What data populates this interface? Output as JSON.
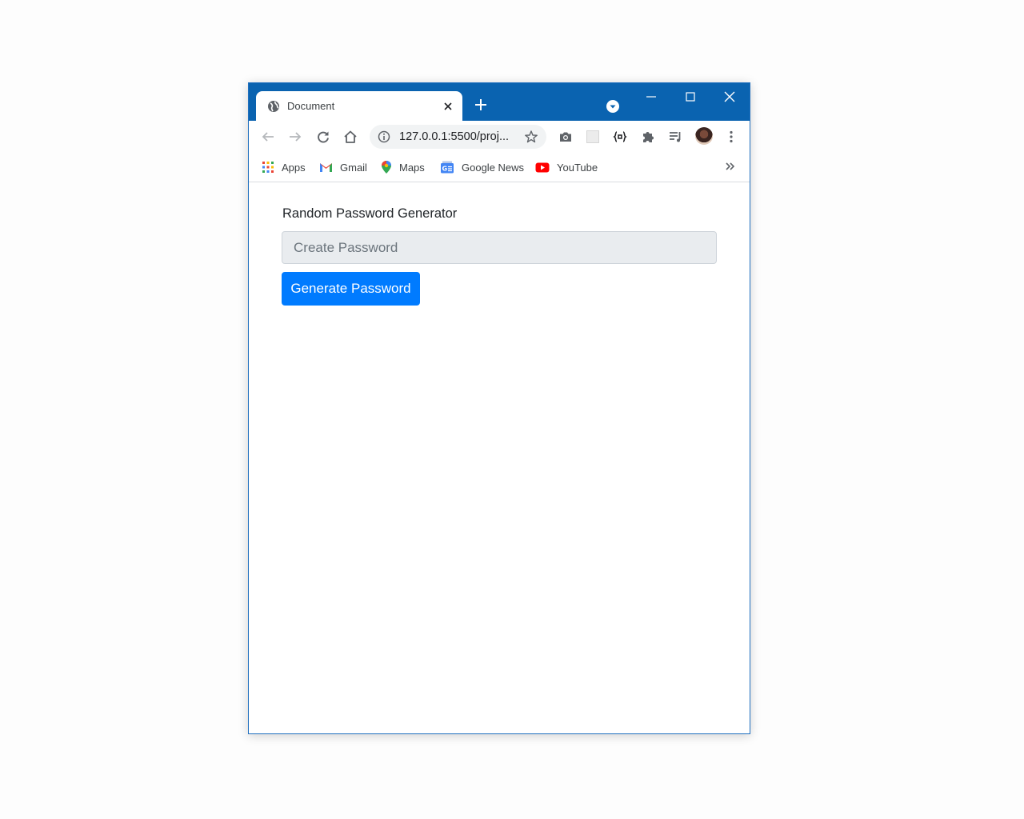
{
  "browser": {
    "tab": {
      "title": "Document"
    },
    "omnibox": {
      "url": "127.0.0.1:5500/proj..."
    },
    "bookmarks": [
      {
        "label": "Apps",
        "icon": "apps-grid-icon"
      },
      {
        "label": "Gmail",
        "icon": "gmail-icon"
      },
      {
        "label": "Maps",
        "icon": "maps-pin-icon"
      },
      {
        "label": "Google News",
        "icon": "google-news-icon"
      },
      {
        "label": "YouTube",
        "icon": "youtube-icon"
      }
    ]
  },
  "page": {
    "heading": "Random Password Generator",
    "password_field": {
      "placeholder": "Create Password",
      "value": ""
    },
    "generate_button": "Generate Password"
  },
  "colors": {
    "titlebar": "#0a63b0",
    "primary_button": "#007bff",
    "input_background": "#e9ecef"
  }
}
